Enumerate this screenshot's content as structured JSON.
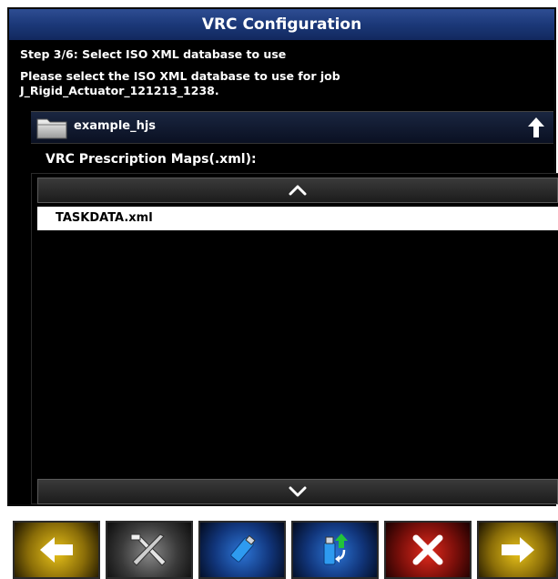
{
  "window": {
    "title": "VRC Configuration",
    "step": "Step 3/6: Select ISO XML database to use",
    "prompt_line1": "Please select the ISO XML database to use for job",
    "prompt_line2": "J_Rigid_Actuator_121213_1238."
  },
  "folder": {
    "name": "example_hjs",
    "icon": "folder-icon",
    "up_icon": "folder-up-icon"
  },
  "list": {
    "label": "VRC Prescription Maps(.xml):",
    "items": [
      "TASKDATA.xml"
    ],
    "selected_index": 0
  },
  "toolbar": {
    "buttons": [
      {
        "icon": "back-arrow-icon",
        "color": "#e8c21a"
      },
      {
        "icon": "tools-icon",
        "color": "#8a8a8a"
      },
      {
        "icon": "usb-drive-icon",
        "color": "#2d76d8"
      },
      {
        "icon": "usb-import-icon",
        "color": "#2d76d8"
      },
      {
        "icon": "cancel-icon",
        "color": "#e22a1d"
      },
      {
        "icon": "next-arrow-icon",
        "color": "#e8c21a"
      }
    ]
  }
}
